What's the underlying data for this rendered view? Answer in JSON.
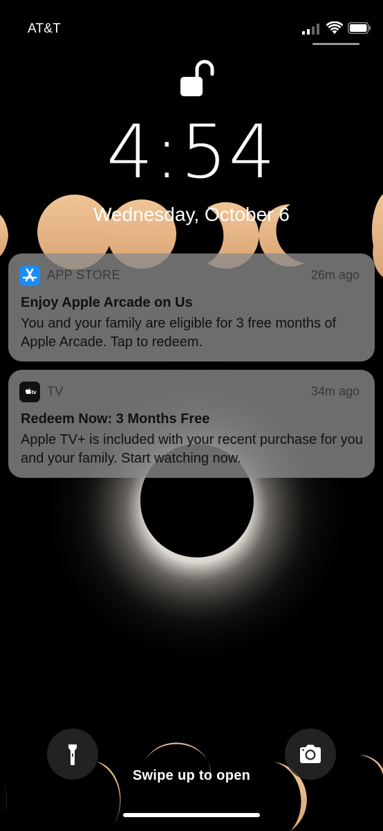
{
  "status_bar": {
    "carrier": "AT&T",
    "signal_icon": "cellular-signal-icon",
    "wifi_icon": "wifi-icon",
    "battery_icon": "battery-icon"
  },
  "lock_screen": {
    "lock_icon": "unlocked-padlock-icon",
    "time": "4:54",
    "date": "Wednesday, October 6"
  },
  "notifications": [
    {
      "app": "APP STORE",
      "app_icon": "app-store-icon",
      "time": "26m ago",
      "title": "Enjoy Apple Arcade on Us",
      "body": "You and your family are eligible for 3 free months of Apple Arcade. Tap to redeem."
    },
    {
      "app": "TV",
      "app_icon": "apple-tv-icon",
      "time": "34m ago",
      "title": "Redeem Now: 3 Months Free",
      "body": "Apple TV+ is included with your recent purchase for you and your family. Start watching now."
    }
  ],
  "bottom": {
    "flashlight_icon": "flashlight-icon",
    "camera_icon": "camera-icon",
    "swipe_hint": "Swipe up to open"
  },
  "colors": {
    "sun_crescent": "#e9b88a",
    "notification_bg": "#8c8c8c",
    "corona": "#d9d5cf",
    "app_store_blue": "#1c8cf6"
  }
}
